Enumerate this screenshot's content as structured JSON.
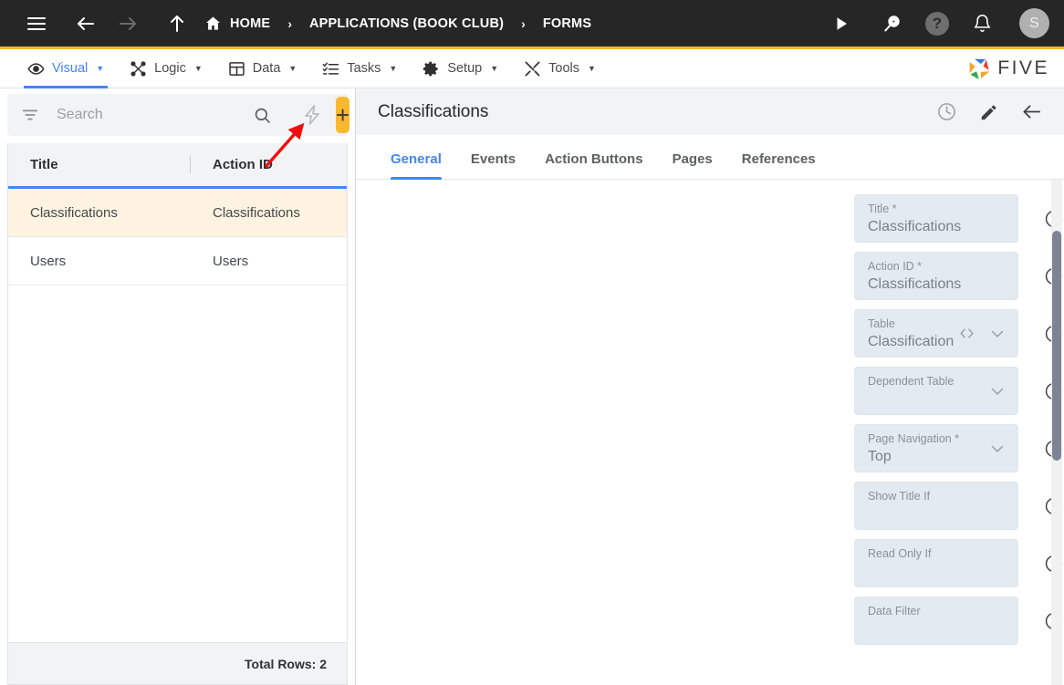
{
  "topbar": {
    "menu_icon": "hamburger-icon",
    "back_icon": "arrow-left-icon",
    "forward_icon": "arrow-right-icon",
    "up_icon": "arrow-up-icon",
    "breadcrumbs": [
      {
        "label": "HOME",
        "icon": "home-icon"
      },
      {
        "label": "APPLICATIONS (BOOK CLUB)",
        "icon": ""
      },
      {
        "label": "FORMS",
        "icon": ""
      }
    ],
    "separator": "›",
    "actions": [
      {
        "name": "run-icon",
        "glyph": "▶"
      },
      {
        "name": "search-play-icon",
        "glyph": ""
      },
      {
        "name": "help-icon",
        "glyph": "?"
      },
      {
        "name": "notifications-bell-icon",
        "glyph": ""
      }
    ],
    "avatar_initial": "S",
    "accent_color": "#f2b828"
  },
  "menubar": {
    "items": [
      {
        "label": "Visual",
        "icon": "eye-icon",
        "caret": "▼",
        "active": true
      },
      {
        "label": "Logic",
        "icon": "nodes-icon",
        "caret": "▼",
        "active": false
      },
      {
        "label": "Data",
        "icon": "grid-icon",
        "caret": "▼",
        "active": false
      },
      {
        "label": "Tasks",
        "icon": "checklist-icon",
        "caret": "▼",
        "active": false
      },
      {
        "label": "Setup",
        "icon": "gear-icon",
        "caret": "▼",
        "active": false
      },
      {
        "label": "Tools",
        "icon": "tools-icon",
        "caret": "▼",
        "active": false
      }
    ],
    "logo_text": "FIVE",
    "active_color": "#4285f4"
  },
  "sidebar": {
    "search": {
      "placeholder": "Search",
      "value": ""
    },
    "filter_icon": "filter-icon",
    "search_icon": "search-icon",
    "bolt_icon": "lightning-bolt-icon",
    "add_label": "+",
    "columns": [
      "Title",
      "Action ID"
    ],
    "rows": [
      {
        "title": "Classifications",
        "action_id": "Classifications",
        "selected": true
      },
      {
        "title": "Users",
        "action_id": "Users",
        "selected": false
      }
    ],
    "footer": "Total Rows: 2",
    "selected_row_color": "#fdf3e0"
  },
  "main": {
    "title": "Classifications",
    "head_icons": [
      {
        "name": "history-clock-icon"
      },
      {
        "name": "edit-pencil-icon"
      },
      {
        "name": "back-arrow-icon"
      }
    ],
    "tabs": [
      {
        "label": "General",
        "active": true
      },
      {
        "label": "Events",
        "active": false
      },
      {
        "label": "Action Buttons",
        "active": false
      },
      {
        "label": "Pages",
        "active": false
      },
      {
        "label": "References",
        "active": false
      }
    ],
    "fields": [
      {
        "label": "Title *",
        "value": "Classifications",
        "icons": []
      },
      {
        "label": "Action ID *",
        "value": "Classifications",
        "icons": []
      },
      {
        "label": "Table",
        "value": "Classification",
        "icons": [
          "code-icon",
          "chevron-down-icon"
        ]
      },
      {
        "label": "Dependent Table",
        "value": "",
        "icons": [
          "chevron-down-icon"
        ]
      },
      {
        "label": "Page Navigation *",
        "value": "Top",
        "icons": [
          "chevron-down-icon"
        ]
      },
      {
        "label": "Show Title If",
        "value": "",
        "icons": []
      },
      {
        "label": "Read Only If",
        "value": "",
        "icons": []
      },
      {
        "label": "Data Filter",
        "value": "",
        "icons": []
      }
    ],
    "help_glyph": "?"
  },
  "annotation": {
    "arrow_color": "#f20d0d",
    "points_to": "lightning-bolt-icon"
  }
}
